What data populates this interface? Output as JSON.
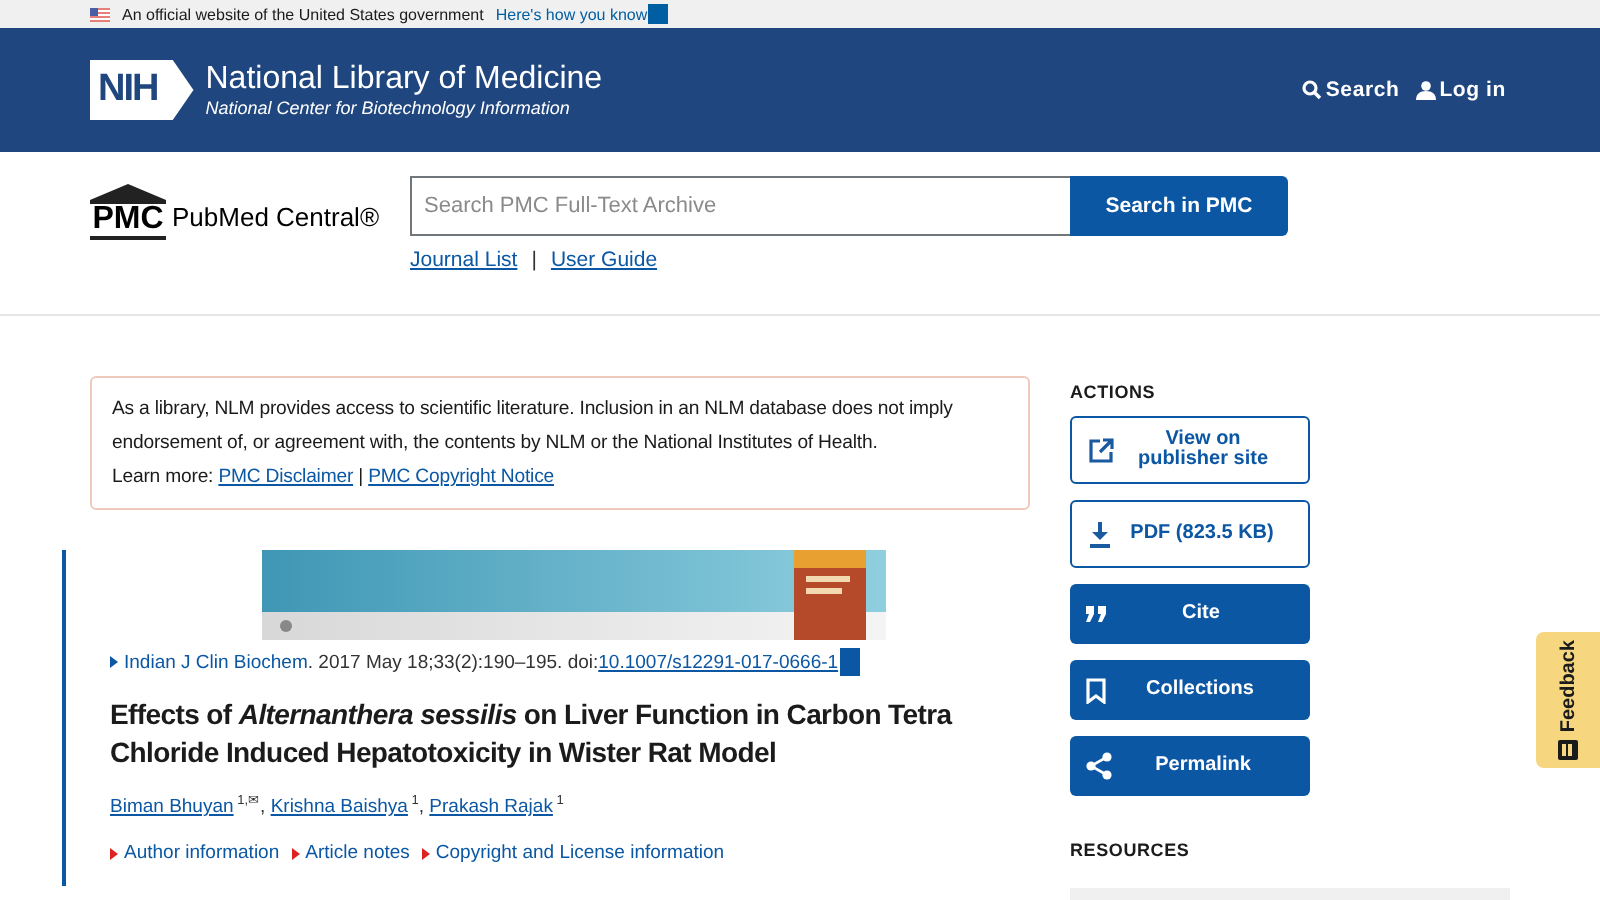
{
  "gov_banner": {
    "text": "An official website of the United States government",
    "link": "Here's how you know"
  },
  "header": {
    "logo": "NIH",
    "title": "National Library of Medicine",
    "subtitle": "National Center for Biotechnology Information",
    "links": [
      {
        "kind": "search",
        "label": "Search"
      },
      {
        "kind": "user",
        "label": "Log in"
      }
    ]
  },
  "pmc": {
    "logo": "PMC",
    "name": "PubMed Central®",
    "search": {
      "placeholder": "Search PMC Full-Text Archive"
    },
    "search_button": "Search in PMC",
    "links": [
      "Journal List",
      "User Guide"
    ],
    "separator": "|"
  },
  "disclaimer": {
    "text": "As a library, NLM provides access to scientific literature. Inclusion in an NLM database does not imply endorsement of, or agreement with, the contents by NLM or the National Institutes of Health.",
    "learn_more": "Learn more:",
    "links": [
      "PMC Disclaimer",
      "PMC Copyright Notice"
    ],
    "separator": "|"
  },
  "article": {
    "journal": "Indian J Clin Biochem",
    "citation": ". 2017 May 18;33(2):190–195. doi: ",
    "doi": "10.1007/s12291-017-0666-1",
    "title": "Effects of *Alternanthera sessilis* on Liver Function in Carbon Tetra Chloride Induced Hepatotoxicity in Wister Rat Model",
    "author_separator": ",",
    "authors": [
      {
        "name": "Biman Bhuyan",
        "sup": "1,✉"
      },
      {
        "name": "Krishna Baishya",
        "sup": "1"
      },
      {
        "name": "Prakash Rajak",
        "sup": "1"
      }
    ],
    "info_links": [
      "Author information",
      "Article notes",
      "Copyright and License information"
    ]
  },
  "actions": {
    "heading": "ACTIONS",
    "buttons": [
      {
        "kind": "external",
        "label": "View on publisher site"
      },
      {
        "kind": "download",
        "label": "PDF (823.5 KB)"
      },
      {
        "kind": "quote",
        "label": "Cite"
      },
      {
        "kind": "bookmark",
        "label": "Collections"
      },
      {
        "kind": "share",
        "label": "Permalink"
      }
    ]
  },
  "resources": {
    "heading": "RESOURCES"
  },
  "feedback": {
    "label": "Feedback"
  }
}
